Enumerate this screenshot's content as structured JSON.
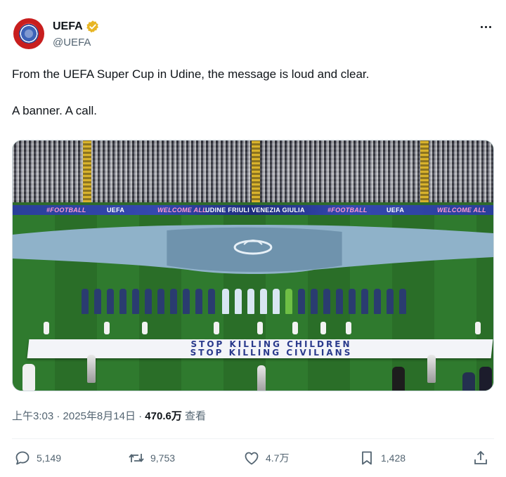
{
  "account": {
    "name": "UEFA",
    "handle": "@UEFA",
    "avatar_icon": "uefa-logo-icon",
    "verified_icon": "gold-verified-badge-icon",
    "verified_color": "#e8b625"
  },
  "tweet": {
    "lines": [
      "From the UEFA Super Cup in Udine, the message is loud and clear.",
      "A banner. A call."
    ]
  },
  "media": {
    "board_texts": [
      "#FOOTBALL",
      "UEFA",
      "WELCOME ALL",
      "UDINE FRIULI VENEZIA GIULIA",
      "#FOOTBALL",
      "UEFA",
      "WELCOME ALL"
    ],
    "banner_lines": [
      "STOP KILLING CHILDREN",
      "STOP KILLING CIVILIANS"
    ]
  },
  "meta": {
    "time": "上午3:03",
    "separator": "·",
    "date": "2025年8月14日",
    "views_count": "470.6万",
    "views_label": "查看"
  },
  "actions": {
    "replies": "5,149",
    "reposts": "9,753",
    "likes": "4.7万",
    "bookmarks": "1,428"
  },
  "colors": {
    "text_primary": "#0f1419",
    "text_secondary": "#536471",
    "divider": "#eff3f4"
  }
}
